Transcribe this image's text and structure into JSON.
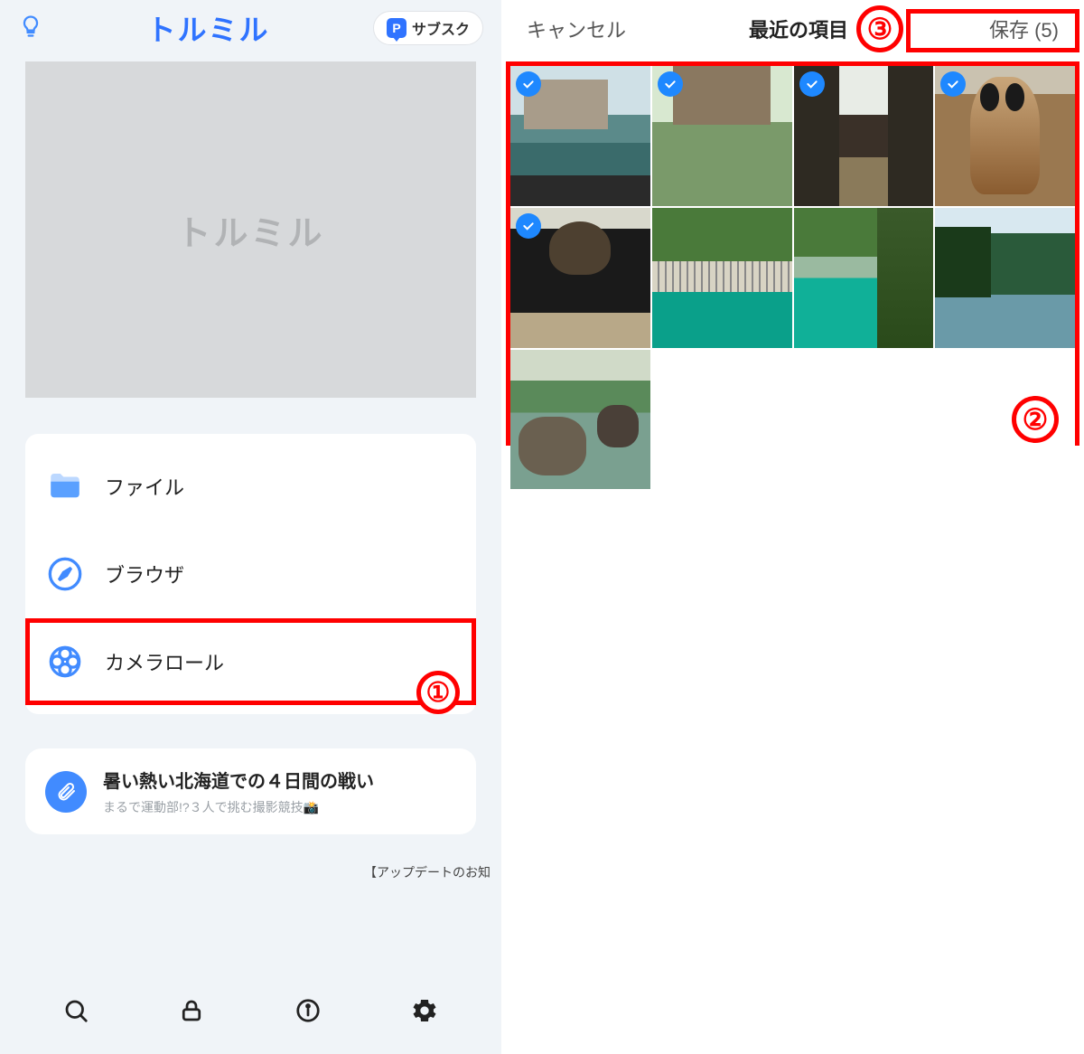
{
  "left": {
    "app_title": "トルミル",
    "hero_text": "トルミル",
    "subscribe_label": "サブスク",
    "menu": {
      "file": "ファイル",
      "browser": "ブラウザ",
      "camera_roll": "カメラロール"
    },
    "article": {
      "title": "暑い熱い北海道での４日間の戦い",
      "subtitle": "まるで運動部!?３人で挑む撮影競技📸"
    },
    "update_note": "【アップデートのお知"
  },
  "right": {
    "cancel": "キャンセル",
    "picker_title": "最近の項目",
    "save": "保存 (5)",
    "thumbs": [
      {
        "selected": true
      },
      {
        "selected": true
      },
      {
        "selected": true
      },
      {
        "selected": true
      },
      {
        "selected": true
      },
      {
        "selected": false
      },
      {
        "selected": false
      },
      {
        "selected": false
      },
      {
        "selected": false
      }
    ]
  },
  "annotations": {
    "n1": "①",
    "n2": "②",
    "n3": "③"
  }
}
